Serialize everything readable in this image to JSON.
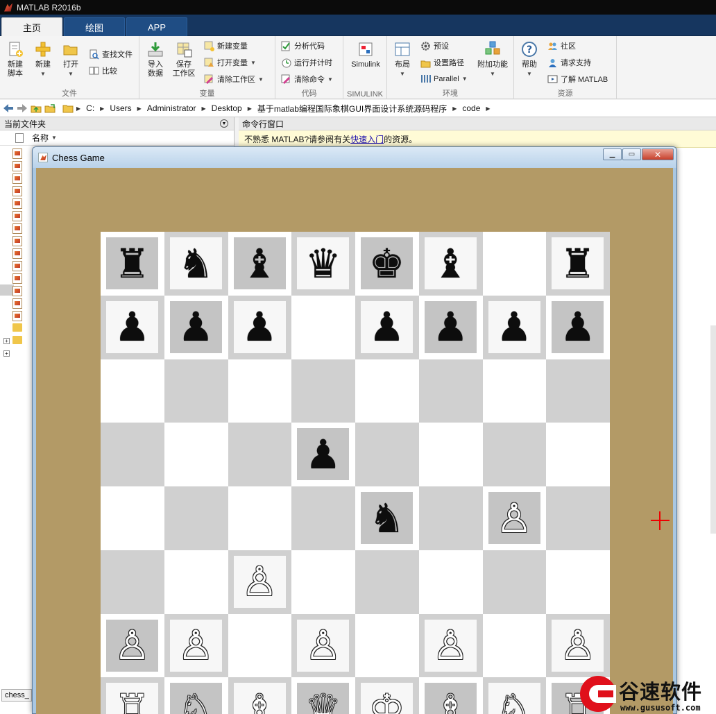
{
  "app": {
    "title": "MATLAB R2016b"
  },
  "tabs": [
    {
      "label": "主页",
      "active": true
    },
    {
      "label": "绘图",
      "active": false
    },
    {
      "label": "APP",
      "active": false
    }
  ],
  "ribbon": {
    "file": {
      "label": "文件",
      "new_script": "新建\n脚本",
      "new": "新建",
      "open": "打开",
      "find_files": "查找文件",
      "compare": "比较"
    },
    "variable": {
      "label": "变量",
      "import": "导入\n数据",
      "save_ws": "保存\n工作区",
      "new_var": "新建变量",
      "open_var": "打开变量",
      "clear_ws": "清除工作区"
    },
    "code": {
      "label": "代码",
      "analyze": "分析代码",
      "run_time": "运行并计时",
      "clear_cmd": "清除命令"
    },
    "simulink": {
      "label": "SIMULINK",
      "simulink": "Simulink"
    },
    "env": {
      "label": "环境",
      "layout": "布局",
      "prefs": "预设",
      "set_path": "设置路径",
      "parallel": "Parallel",
      "addons": "附加功能"
    },
    "resources": {
      "label": "资源",
      "help": "帮助",
      "community": "社区",
      "support": "请求支持",
      "learn": "了解 MATLAB"
    }
  },
  "path": [
    "C:",
    "Users",
    "Administrator",
    "Desktop",
    "基于matlab编程国际象棋GUI界面设计系统源码程序",
    "code"
  ],
  "left_panel": {
    "title": "当前文件夹",
    "col_name": "名称",
    "bottom_tab": "chess_"
  },
  "cmd_panel": {
    "title": "命令行窗口",
    "info_prefix": "不熟悉 MATLAB?请参阅有关",
    "info_link": "快速入门",
    "info_suffix": "的资源。"
  },
  "figure": {
    "title": "Chess Game"
  },
  "board": [
    [
      "♜",
      "♞",
      "♝",
      "♛",
      "♚",
      "♝",
      "",
      "♜"
    ],
    [
      "♟",
      "♟",
      "♟",
      "",
      "♟",
      "♟",
      "♟",
      "♟"
    ],
    [
      "",
      "",
      "",
      "",
      "",
      "",
      "",
      ""
    ],
    [
      "",
      "",
      "",
      "♟",
      "",
      "",
      "",
      ""
    ],
    [
      "",
      "",
      "",
      "",
      "♞",
      "",
      "♙",
      ""
    ],
    [
      "",
      "",
      "♙",
      "",
      "",
      "",
      "",
      ""
    ],
    [
      "♙",
      "♙",
      "",
      "♙",
      "",
      "♙",
      "",
      "♙"
    ],
    [
      "♖",
      "♘",
      "♗",
      "♕",
      "♔",
      "♗",
      "♘",
      "♖"
    ]
  ],
  "watermark": {
    "text": "谷速软件",
    "url": "www.gususoft.com"
  },
  "colors": {
    "board_bg": "#b39a66",
    "light_square": "#ffffff",
    "dark_square": "#d0d0d0",
    "tab_bar": "#16365f"
  }
}
